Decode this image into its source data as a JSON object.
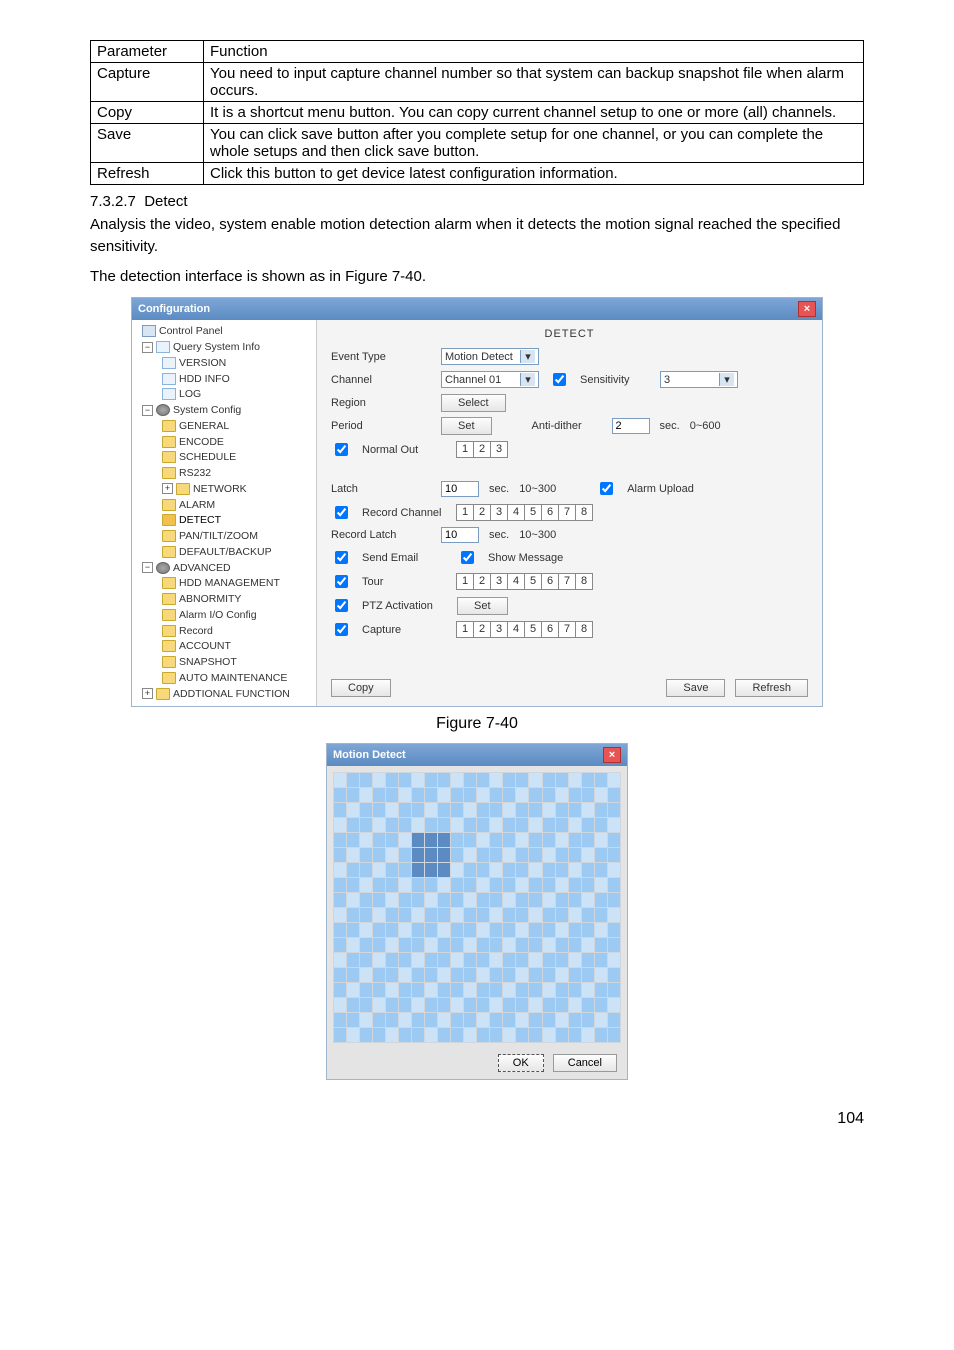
{
  "table": {
    "header": [
      "Parameter",
      "Function"
    ],
    "rows": [
      [
        "Capture",
        "You need to input capture channel number so that system can backup snapshot file when alarm occurs."
      ],
      [
        "Copy",
        "It is a shortcut menu button. You can copy current channel setup to one or more (all) channels."
      ],
      [
        "Save",
        "You can click save button after you complete setup for one channel, or you can complete the whole setups and then click save button."
      ],
      [
        "Refresh",
        "Click this button to get device latest configuration information."
      ]
    ]
  },
  "section": {
    "number": "7.3.2.7",
    "title": "Detect",
    "para1": "Analysis the video, system enable motion detection alarm when it detects the motion signal reached the specified sensitivity.",
    "para2": "The detection interface is shown as in Figure 7-40."
  },
  "figcaption1": "Figure 7-40",
  "config": {
    "title": "Configuration",
    "tree": [
      {
        "lvl": 1,
        "icon": "computer",
        "label": "Control Panel",
        "expand": ""
      },
      {
        "lvl": 1,
        "icon": "page",
        "label": "Query System Info",
        "expand": "-"
      },
      {
        "lvl": 2,
        "icon": "page",
        "label": "VERSION"
      },
      {
        "lvl": 2,
        "icon": "page",
        "label": "HDD INFO"
      },
      {
        "lvl": 2,
        "icon": "page",
        "label": "LOG"
      },
      {
        "lvl": 1,
        "icon": "gear",
        "label": "System Config",
        "expand": "-"
      },
      {
        "lvl": 2,
        "icon": "folder",
        "label": "GENERAL"
      },
      {
        "lvl": 2,
        "icon": "folder",
        "label": "ENCODE"
      },
      {
        "lvl": 2,
        "icon": "folder",
        "label": "SCHEDULE"
      },
      {
        "lvl": 2,
        "icon": "folder",
        "label": "RS232"
      },
      {
        "lvl": 2,
        "icon": "folder",
        "label": "NETWORK",
        "expand": "+"
      },
      {
        "lvl": 2,
        "icon": "folder",
        "label": "ALARM"
      },
      {
        "lvl": 2,
        "icon": "folder-open",
        "label": "DETECT",
        "sel": true
      },
      {
        "lvl": 2,
        "icon": "folder",
        "label": "PAN/TILT/ZOOM"
      },
      {
        "lvl": 2,
        "icon": "folder",
        "label": "DEFAULT/BACKUP"
      },
      {
        "lvl": 1,
        "icon": "gear",
        "label": "ADVANCED",
        "expand": "-"
      },
      {
        "lvl": 2,
        "icon": "folder",
        "label": "HDD MANAGEMENT"
      },
      {
        "lvl": 2,
        "icon": "folder",
        "label": "ABNORMITY"
      },
      {
        "lvl": 2,
        "icon": "folder",
        "label": "Alarm I/O Config"
      },
      {
        "lvl": 2,
        "icon": "folder",
        "label": "Record"
      },
      {
        "lvl": 2,
        "icon": "folder",
        "label": "ACCOUNT"
      },
      {
        "lvl": 2,
        "icon": "folder",
        "label": "SNAPSHOT"
      },
      {
        "lvl": 2,
        "icon": "folder",
        "label": "AUTO MAINTENANCE"
      },
      {
        "lvl": 1,
        "icon": "folder",
        "label": "ADDTIONAL FUNCTION",
        "expand": "+"
      }
    ],
    "pane": {
      "title": "DETECT",
      "eventTypeLabel": "Event Type",
      "eventType": "Motion Detect",
      "channelLabel": "Channel",
      "channel": "Channel 01",
      "sensitivityLabel": "Sensitivity",
      "sensitivity": "3",
      "regionLabel": "Region",
      "regionBtn": "Select",
      "periodLabel": "Period",
      "periodBtn": "Set",
      "antiDitherLabel": "Anti-dither",
      "antiDither": "2",
      "antiDitherUnit": "sec.",
      "antiDitherRange": "0~600",
      "normalOutLabel": "Normal Out",
      "normalOut": [
        "1",
        "2",
        "3"
      ],
      "latchLabel": "Latch",
      "latch": "10",
      "latchUnit": "sec.",
      "latchRange": "10~300",
      "alarmUploadLabel": "Alarm Upload",
      "recordChannelLabel": "Record Channel",
      "recordChannel": [
        "1",
        "2",
        "3",
        "4",
        "5",
        "6",
        "7",
        "8"
      ],
      "recordLatchLabel": "Record Latch",
      "recordLatch": "10",
      "recordLatchUnit": "sec.",
      "recordLatchRange": "10~300",
      "sendEmailLabel": "Send Email",
      "showMessageLabel": "Show Message",
      "tourLabel": "Tour",
      "tour": [
        "1",
        "2",
        "3",
        "4",
        "5",
        "6",
        "7",
        "8"
      ],
      "ptzLabel": "PTZ Activation",
      "ptzBtn": "Set",
      "captureLabel": "Capture",
      "capture": [
        "1",
        "2",
        "3",
        "4",
        "5",
        "6",
        "7",
        "8"
      ],
      "copyBtn": "Copy",
      "saveBtn": "Save",
      "refreshBtn": "Refresh"
    }
  },
  "md": {
    "title": "Motion Detect",
    "ok": "OK",
    "cancel": "Cancel"
  },
  "pagenum": "104"
}
